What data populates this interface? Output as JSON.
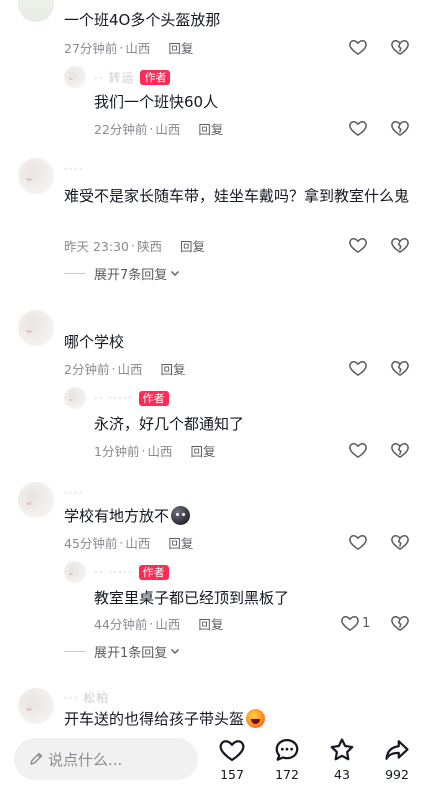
{
  "comments": [
    {
      "text": "一个班4O多个头盔放那",
      "time": "27分钟前",
      "location": "山西",
      "reply_label": "回复",
      "replies": [
        {
          "name": "·· 转运",
          "badge": "作者",
          "text": "我们一个班快60人",
          "time": "22分钟前",
          "location": "山西",
          "reply_label": "回复"
        }
      ]
    },
    {
      "name": "····",
      "text": "难受不是家长随车带，娃坐车戴吗？拿到教室什么鬼",
      "time": "昨天 23:30",
      "location": "陕西",
      "reply_label": "回复",
      "expand": "展开7条回复"
    },
    {
      "text": "哪个学校",
      "time": "2分钟前",
      "location": "山西",
      "reply_label": "回复",
      "replies": [
        {
          "name": "·· ·····",
          "badge": "作者",
          "text": "永济，好几个都通知了",
          "time": "1分钟前",
          "location": "山西",
          "reply_label": "回复"
        }
      ]
    },
    {
      "name": "····",
      "text": "学校有地方放不",
      "time": "45分钟前",
      "location": "山西",
      "reply_label": "回复",
      "replies": [
        {
          "name": "·· ·····",
          "badge": "作者",
          "text": "教室里桌子都已经顶到黑板了",
          "time": "44分钟前",
          "location": "山西",
          "reply_label": "回复",
          "likes": "1"
        }
      ],
      "expand": "展开1条回复"
    },
    {
      "name": "··· 松柏",
      "text": "开车送的也得给孩子带头盔"
    }
  ],
  "bottom_bar": {
    "input_placeholder": "说点什么...",
    "likes": "157",
    "comments": "172",
    "favorites": "43",
    "shares": "992"
  },
  "colors": {
    "author_badge": "#fe2c55",
    "text": "#161823",
    "meta": "#8a8b91"
  }
}
